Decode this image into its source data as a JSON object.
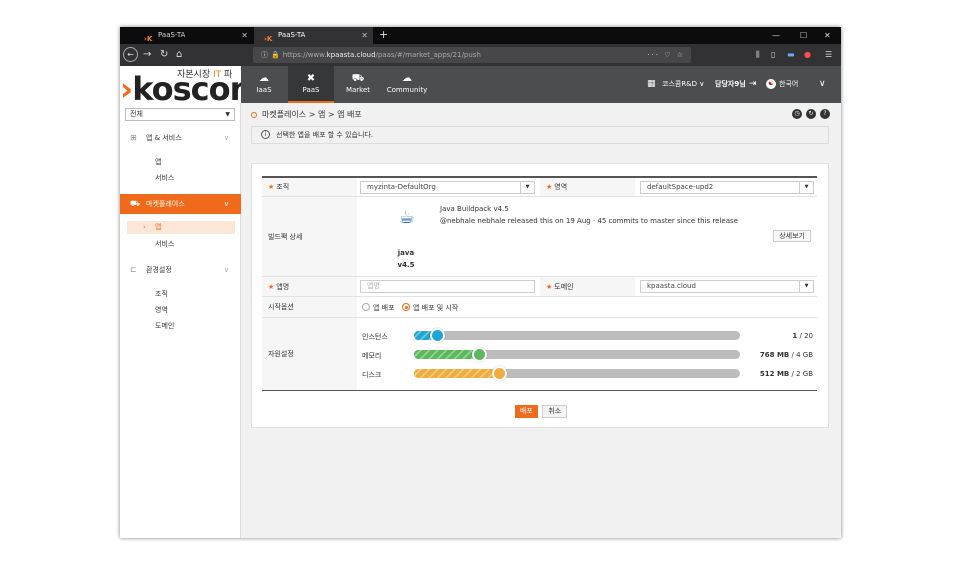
{
  "browser": {
    "tabs": [
      {
        "favicon": "›K",
        "title": "PaaS-TA"
      },
      {
        "favicon": "›K",
        "title": "PaaS-TA"
      }
    ],
    "new_tab": "+",
    "url_scheme": "https://www.",
    "url_host": "kpaasta.cloud",
    "url_path": "/paas/#/market_apps/21/push",
    "url_right_icons": "··· ♡ ☆",
    "window_controls": {
      "minimize": "—",
      "maximize": "☐",
      "close": "✕"
    }
  },
  "header": {
    "tagline_prefix": "자본시장 ",
    "tagline_accent": "IT",
    "tagline_suffix": " 파",
    "logo_arrow": "›",
    "logo_text": "koscom",
    "nav": [
      {
        "icon": "☁",
        "label": "IaaS"
      },
      {
        "icon": "✖",
        "label": "PaaS"
      },
      {
        "icon": "⛟",
        "label": "Market"
      },
      {
        "icon": "☁",
        "label": "Community"
      }
    ],
    "org": "코스콤R&D",
    "user": "담당자9님",
    "language": "한국어"
  },
  "sidebar": {
    "scope_select": "전체",
    "groups": [
      {
        "label": "앱 & 서비스",
        "items": [
          "앱",
          "서비스"
        ]
      },
      {
        "label": "마켓플레이스",
        "items": [
          "앱",
          "서비스"
        ]
      },
      {
        "label": "환경설정",
        "items": [
          "조직",
          "영역",
          "도메인"
        ]
      }
    ]
  },
  "main": {
    "breadcrumb": "마켓플레이스 > 앱 > 앱 배포",
    "notice": "선택한 앱을 배포 할 수 있습니다.",
    "form": {
      "org_label": "조직",
      "org_value": "myzinta-DefaultOrg",
      "space_label": "영역",
      "space_value": "defaultSpace-upd2",
      "buildpack_label": "빌드팩 상세",
      "buildpack_name": "java",
      "buildpack_version": "v4.5",
      "buildpack_title": "Java Buildpack v4.5",
      "buildpack_desc": "@nebhale nebhale released this on 19 Aug · 45 commits to master since this release",
      "detail_button": "상세보기",
      "app_name_label": "앱명",
      "app_name_placeholder": "앱명",
      "domain_label": "도메인",
      "domain_value": "kpaasta.cloud",
      "start_option_label": "시작옵션",
      "start_options": [
        "앱 배포",
        "앱 배포 및 시작"
      ],
      "start_selected": 1,
      "resource_label": "자원설정",
      "resources": [
        {
          "label": "인스턴스",
          "value": "1",
          "max": " / 20",
          "fraction": 0.07,
          "color": "#1ea5d3"
        },
        {
          "label": "메모리",
          "value": "768 MB",
          "max": " / 4 GB",
          "fraction": 0.2,
          "color": "#5cb85c"
        },
        {
          "label": "디스크",
          "value": "512 MB",
          "max": " / 2 GB",
          "fraction": 0.26,
          "color": "#f0ad3e"
        }
      ]
    },
    "deploy_button": "배포",
    "cancel_button": "취소"
  }
}
